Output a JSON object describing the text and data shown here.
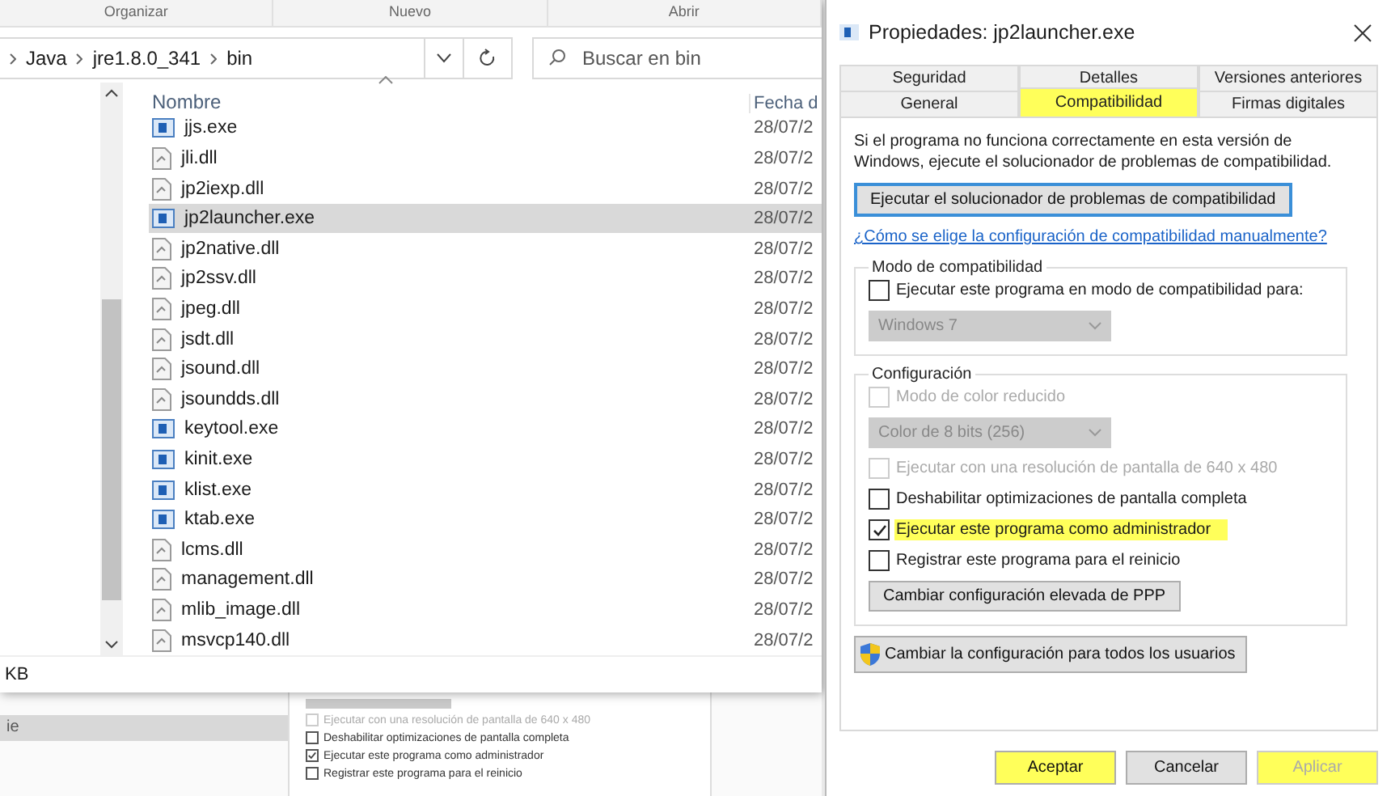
{
  "explorer": {
    "ribbon": [
      "Organizar",
      "Nuevo",
      "Abrir"
    ],
    "breadcrumb": [
      "Java",
      "jre1.8.0_341",
      "bin"
    ],
    "search": {
      "placeholder": "Buscar en bin"
    },
    "columns": [
      "Nombre",
      "Fecha d"
    ],
    "files": [
      {
        "name": "jjs.exe",
        "date": "28/07/2",
        "kind": "exe",
        "selected": false
      },
      {
        "name": "jli.dll",
        "date": "28/07/2",
        "kind": "dll",
        "selected": false
      },
      {
        "name": "jp2iexp.dll",
        "date": "28/07/2",
        "kind": "dll",
        "selected": false
      },
      {
        "name": "jp2launcher.exe",
        "date": "28/07/2",
        "kind": "exe",
        "selected": true
      },
      {
        "name": "jp2native.dll",
        "date": "28/07/2",
        "kind": "dll",
        "selected": false
      },
      {
        "name": "jp2ssv.dll",
        "date": "28/07/2",
        "kind": "dll",
        "selected": false
      },
      {
        "name": "jpeg.dll",
        "date": "28/07/2",
        "kind": "dll",
        "selected": false
      },
      {
        "name": "jsdt.dll",
        "date": "28/07/2",
        "kind": "dll",
        "selected": false
      },
      {
        "name": "jsound.dll",
        "date": "28/07/2",
        "kind": "dll",
        "selected": false
      },
      {
        "name": "jsoundds.dll",
        "date": "28/07/2",
        "kind": "dll",
        "selected": false
      },
      {
        "name": "keytool.exe",
        "date": "28/07/2",
        "kind": "exe",
        "selected": false
      },
      {
        "name": "kinit.exe",
        "date": "28/07/2",
        "kind": "exe",
        "selected": false
      },
      {
        "name": "klist.exe",
        "date": "28/07/2",
        "kind": "exe",
        "selected": false
      },
      {
        "name": "ktab.exe",
        "date": "28/07/2",
        "kind": "exe",
        "selected": false
      },
      {
        "name": "lcms.dll",
        "date": "28/07/2",
        "kind": "dll",
        "selected": false
      },
      {
        "name": "management.dll",
        "date": "28/07/2",
        "kind": "dll",
        "selected": false
      },
      {
        "name": "mlib_image.dll",
        "date": "28/07/2",
        "kind": "dll",
        "selected": false
      },
      {
        "name": "msvcp140.dll",
        "date": "28/07/2",
        "kind": "dll",
        "selected": false
      }
    ],
    "status_bar": "KB"
  },
  "background": {
    "nav_item": "ie",
    "settings": [
      {
        "label": "Ejecutar con una resolución de pantalla de 640 x 480",
        "checked": false,
        "disabled": true
      },
      {
        "label": "Deshabilitar optimizaciones de pantalla completa",
        "checked": false,
        "disabled": false
      },
      {
        "label": "Ejecutar este programa como administrador",
        "checked": true,
        "disabled": false
      },
      {
        "label": "Registrar este programa para el reinicio",
        "checked": false,
        "disabled": false
      }
    ]
  },
  "dialog": {
    "title": "Propiedades: jp2launcher.exe",
    "tab_rows": [
      [
        {
          "label": "Seguridad",
          "selected": false,
          "highlighted": false
        },
        {
          "label": "Detalles",
          "selected": false,
          "highlighted": false
        },
        {
          "label": "Versiones anteriores",
          "selected": false,
          "highlighted": false
        }
      ],
      [
        {
          "label": "General",
          "selected": false,
          "highlighted": false
        },
        {
          "label": "Compatibilidad",
          "selected": true,
          "highlighted": true
        },
        {
          "label": "Firmas digitales",
          "selected": false,
          "highlighted": false
        }
      ]
    ],
    "intro": "Si el programa no funciona correctamente en esta versión de Windows, ejecute el solucionador de problemas de compatibilidad.",
    "troubleshooter_button": "Ejecutar el solucionador de problemas de compatibilidad",
    "help_link": "¿Cómo se elige la configuración de compatibilidad manualmente?",
    "groups": [
      {
        "title": "Modo de compatibilidad",
        "items": [
          {
            "kind": "checkbox",
            "label": "Ejecutar este programa en modo de compatibilidad para:",
            "checked": false,
            "disabled": false,
            "highlighted": false
          },
          {
            "kind": "dropdown",
            "value": "Windows 7",
            "disabled": true
          }
        ]
      },
      {
        "title": "Configuración",
        "items": [
          {
            "kind": "checkbox",
            "label": "Modo de color reducido",
            "checked": false,
            "disabled": true,
            "highlighted": false
          },
          {
            "kind": "dropdown",
            "value": "Color de 8 bits (256)",
            "disabled": true
          },
          {
            "kind": "checkbox",
            "label": "Ejecutar con una resolución de pantalla de 640 x 480",
            "checked": false,
            "disabled": true,
            "highlighted": false
          },
          {
            "kind": "checkbox",
            "label": "Deshabilitar optimizaciones de pantalla completa",
            "checked": false,
            "disabled": false,
            "highlighted": false
          },
          {
            "kind": "checkbox",
            "label": "Ejecutar este programa como administrador",
            "checked": true,
            "disabled": false,
            "highlighted": true
          },
          {
            "kind": "checkbox",
            "label": "Registrar este programa para el reinicio",
            "checked": false,
            "disabled": false,
            "highlighted": false
          },
          {
            "kind": "button",
            "label": "Cambiar configuración elevada de PPP"
          }
        ]
      }
    ],
    "all_users_button": "Cambiar la configuración para todos los usuarios",
    "buttons": [
      {
        "label": "Aceptar",
        "disabled": false,
        "highlighted": true
      },
      {
        "label": "Cancelar",
        "disabled": false,
        "highlighted": false
      },
      {
        "label": "Aplicar",
        "disabled": true,
        "highlighted": true
      }
    ]
  }
}
